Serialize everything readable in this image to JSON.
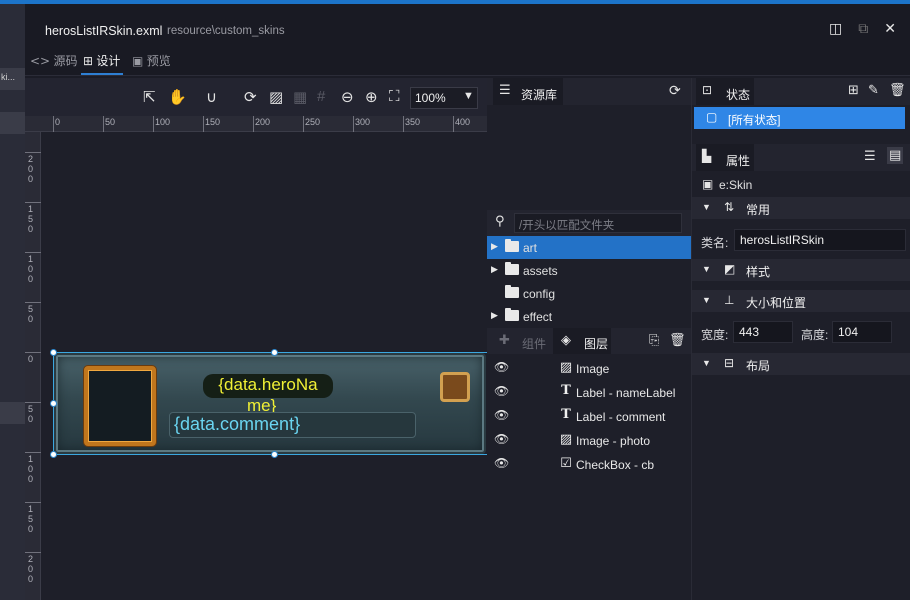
{
  "title_bar": {
    "file_name": "herosListIRSkin.exml",
    "path": "resource\\custom_skins",
    "icons": [
      "split-view-icon",
      "popout-icon",
      "close-icon"
    ]
  },
  "left_strip": {
    "label": "ki..."
  },
  "view_tabs": [
    {
      "label": "源码",
      "icon": "code-icon"
    },
    {
      "label": "设计",
      "icon": "design-icon"
    },
    {
      "label": "预览",
      "icon": "preview-icon"
    }
  ],
  "canvas_toolbar": {
    "tools": [
      "select-arrow-icon",
      "hand-pan-icon",
      "magnet-snap-icon",
      "refresh-icon",
      "image-icon",
      "grid-icon",
      "hash-grid-icon",
      "zoom-out-icon",
      "zoom-in-icon",
      "fit-screen-icon"
    ],
    "zoom": "100%"
  },
  "ruler": {
    "horizontal": [
      "0",
      "50",
      "100",
      "150",
      "200",
      "250",
      "300",
      "350",
      "400"
    ],
    "vertical": [
      "200",
      "150",
      "100",
      "50",
      "0",
      "50",
      "100",
      "150",
      "200"
    ]
  },
  "skin_preview": {
    "name_label_line1": "{data.heroNa",
    "name_label_line2": "me}",
    "comment_label": "{data.comment}"
  },
  "resource_panel": {
    "title": "资源库",
    "search_placeholder": "/开头以匹配文件夹",
    "folders": [
      {
        "name": "art",
        "expandable": true,
        "selected": true
      },
      {
        "name": "assets",
        "expandable": true,
        "selected": false
      },
      {
        "name": "config",
        "expandable": false,
        "selected": false
      },
      {
        "name": "effect",
        "expandable": true,
        "selected": false
      }
    ]
  },
  "layers_panel": {
    "components_tab": "组件",
    "layers_tab": "图层",
    "layers": [
      {
        "label": "Image",
        "icon": "image-icon"
      },
      {
        "label": "Label - nameLabel",
        "icon": "text-icon"
      },
      {
        "label": "Label - comment",
        "icon": "text-icon"
      },
      {
        "label": "Image - photo",
        "icon": "image-icon"
      },
      {
        "label": "CheckBox - cb",
        "icon": "checkbox-icon"
      }
    ]
  },
  "state_panel": {
    "title": "状态",
    "all_states": "[所有状态]"
  },
  "properties_panel": {
    "title": "属性",
    "type": "e:Skin",
    "groups": {
      "common": "常用",
      "style": "样式",
      "size_position": "大小和位置",
      "layout": "布局"
    },
    "class_name_label": "类名:",
    "class_name_value": "herosListIRSkin",
    "width_label": "宽度:",
    "width_value": "443",
    "height_label": "高度:",
    "height_value": "104"
  },
  "colors": {
    "accent": "#2f86e6",
    "selection": "#2372c7",
    "name_text": "#f0f035",
    "comment_text": "#6ad4f0"
  }
}
